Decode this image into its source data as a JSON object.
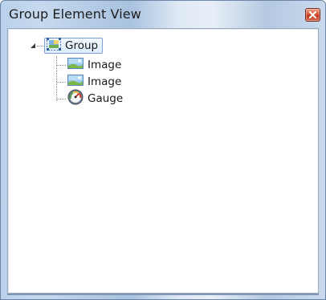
{
  "window": {
    "title": "Group Element View"
  },
  "tree": {
    "root": {
      "label": "Group",
      "icon": "group-icon",
      "expanded": true,
      "selected": true
    },
    "children": [
      {
        "label": "Image",
        "icon": "image-icon"
      },
      {
        "label": "Image",
        "icon": "image-icon"
      },
      {
        "label": "Gauge",
        "icon": "gauge-icon"
      }
    ]
  },
  "colors": {
    "selection_border": "#7da2ce",
    "close_button": "#c43a1f"
  }
}
